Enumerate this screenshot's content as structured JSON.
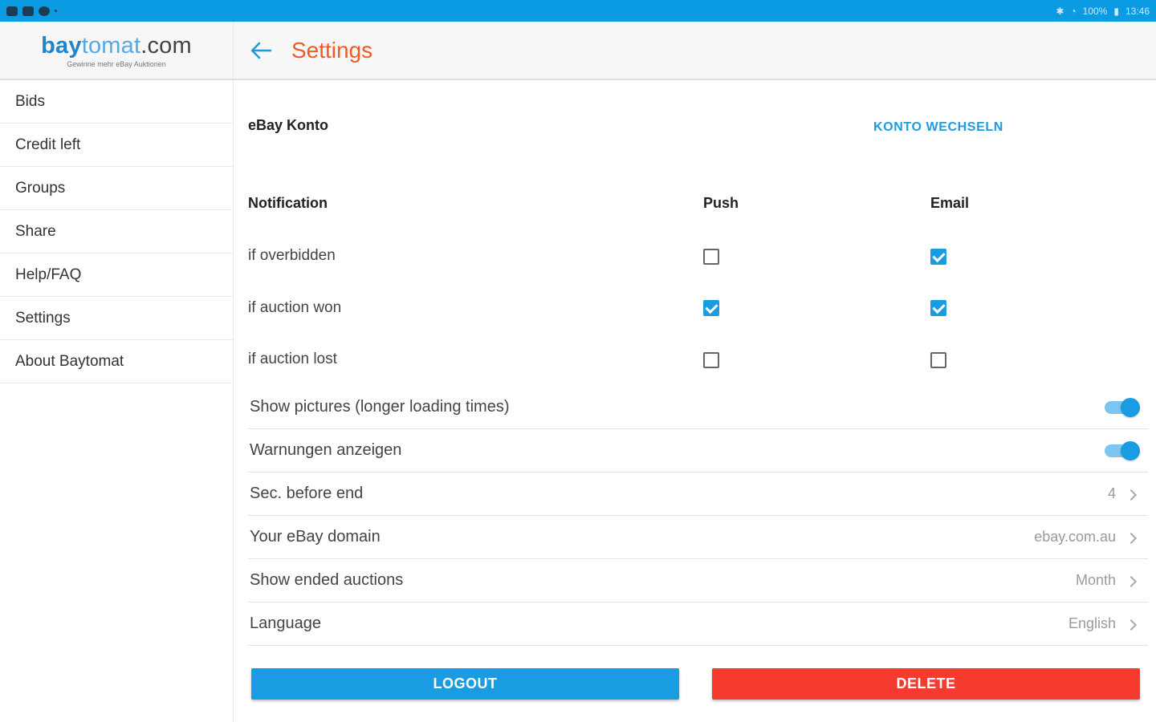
{
  "status_bar": {
    "battery": "100%",
    "time": "13:46"
  },
  "brand": {
    "logo_part1": "bay",
    "logo_part2": "tomat",
    "logo_part3": ".com",
    "tagline": "Gewinne mehr eBay Auktionen"
  },
  "sidebar": {
    "items": [
      {
        "label": "Bids"
      },
      {
        "label": "Credit left"
      },
      {
        "label": "Groups"
      },
      {
        "label": "Share"
      },
      {
        "label": "Help/FAQ"
      },
      {
        "label": "Settings"
      },
      {
        "label": "About Baytomat"
      }
    ]
  },
  "header": {
    "title": "Settings"
  },
  "main": {
    "ebay_account_label": "eBay Konto",
    "switch_account_link": "KONTO WECHSELN",
    "notifications": {
      "header_label": "Notification",
      "header_push": "Push",
      "header_email": "Email",
      "rows": [
        {
          "label": "if overbidden",
          "push": false,
          "email": true
        },
        {
          "label": "if auction won",
          "push": true,
          "email": true
        },
        {
          "label": "if auction lost",
          "push": false,
          "email": false
        }
      ]
    },
    "settings": [
      {
        "label": "Show pictures (longer loading times)",
        "type": "toggle",
        "on": true
      },
      {
        "label": "Warnungen anzeigen",
        "type": "toggle",
        "on": true
      },
      {
        "label": "Sec. before end",
        "type": "value",
        "value": "4"
      },
      {
        "label": "Your eBay domain",
        "type": "value",
        "value": "ebay.com.au"
      },
      {
        "label": "Show ended auctions",
        "type": "value",
        "value": "Month"
      },
      {
        "label": "Language",
        "type": "value",
        "value": "English"
      }
    ],
    "logout_label": "LOGOUT",
    "delete_label": "DELETE"
  },
  "colors": {
    "accent": "#1a9ce3",
    "title": "#f15a24",
    "danger": "#f53a2e"
  }
}
